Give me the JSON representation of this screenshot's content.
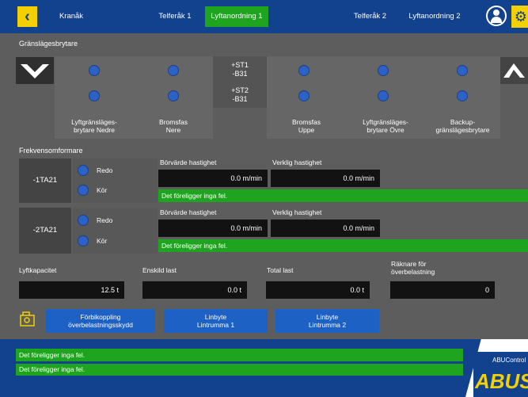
{
  "header": {
    "back_icon": "chevron-left-icon",
    "tabs": [
      {
        "label": "Kranåk"
      },
      {
        "label": "Telferåk 1"
      },
      {
        "label": "Lyftanordning 1"
      },
      {
        "label": "Telferåk 2"
      },
      {
        "label": "Lyftanordning 2"
      }
    ],
    "active_tab": "Lyftanordning 1",
    "user_icon": "user-icon",
    "settings_icon": "gear-icon"
  },
  "limit_switches": {
    "title": "Gränslägesbrytare",
    "down_icon": "arrow-down-icon",
    "up_icon": "arrow-up-icon",
    "columns": [
      {
        "label": "Lyftgränsläges-\nbrytare Nedre"
      },
      {
        "label": "Bromsfas\nNere"
      },
      {
        "st1": "+ST1\n-B31",
        "st2": "+ST2\n-B31"
      },
      {
        "label": "Bromsfas\nUppe"
      },
      {
        "label": "Lyftgränsläges-\nbrytare Övre"
      },
      {
        "label": "Backup-\ngränslägesbrytare"
      }
    ]
  },
  "frequency_converters": {
    "title": "Frekvensomformare",
    "units": [
      {
        "name": "-1TA21",
        "ready_label": "Redo",
        "run_label": "Kör",
        "setpoint_label": "Börvärde hastighet",
        "setpoint_value": "0.0 m/min",
        "actual_label": "Verklig hastighet",
        "actual_value": "0.0 m/min",
        "status": "Det föreligger inga fel."
      },
      {
        "name": "-2TA21",
        "ready_label": "Redo",
        "run_label": "Kör",
        "setpoint_label": "Börvärde hastighet",
        "setpoint_value": "0.0 m/min",
        "actual_label": "Verklig hastighet",
        "actual_value": "0.0 m/min",
        "status": "Det föreligger inga fel."
      }
    ]
  },
  "load": {
    "capacity_label": "Lyftkapacitet",
    "capacity_value": "12.5 t",
    "single_label": "Enskild last",
    "single_value": "0.0 t",
    "total_label": "Total last",
    "total_value": "0.0 t",
    "overload_counter_label": "Räknare för\növerbelastning",
    "overload_counter_value": "0"
  },
  "actions": {
    "bypass_icon": "lift-bypass-icon",
    "bypass_label": "Förbikoppling\növerbelastningsskydd",
    "rope1_label": "Linbyte\nLintrumma 1",
    "rope2_label": "Linbyte\nLintrumma 2"
  },
  "footer": {
    "messages": [
      "Det föreligger inga fel.",
      "Det föreligger inga fel."
    ],
    "brand_small": "ABUControl",
    "brand_logo": "ABUS"
  }
}
